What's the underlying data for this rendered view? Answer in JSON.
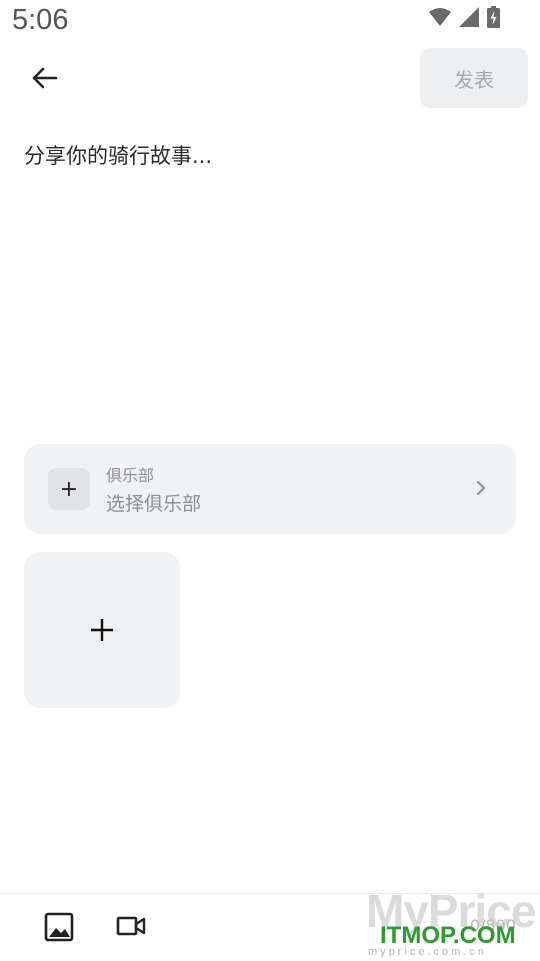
{
  "status_bar": {
    "time": "5:06"
  },
  "header": {
    "publish_label": "发表"
  },
  "composer": {
    "placeholder": "分享你的骑行故事..."
  },
  "club": {
    "label": "俱乐部",
    "value": "选择俱乐部",
    "add_symbol": "+"
  },
  "footer": {
    "char_count": "0/800"
  },
  "watermark": {
    "brand": "MyPrice",
    "site": "ITMOP.COM",
    "url": "myprice.com.cn"
  },
  "icons": [
    "wifi-icon",
    "signal-icon",
    "battery-icon",
    "back-arrow-icon",
    "chevron-right-icon",
    "plus-icon",
    "image-icon",
    "video-icon"
  ],
  "colors": {
    "button_bg": "#eeeff1",
    "card_bg": "#f1f2f4",
    "muted_text": "#8e8f94",
    "watermark_green": "#2e9b2e"
  }
}
